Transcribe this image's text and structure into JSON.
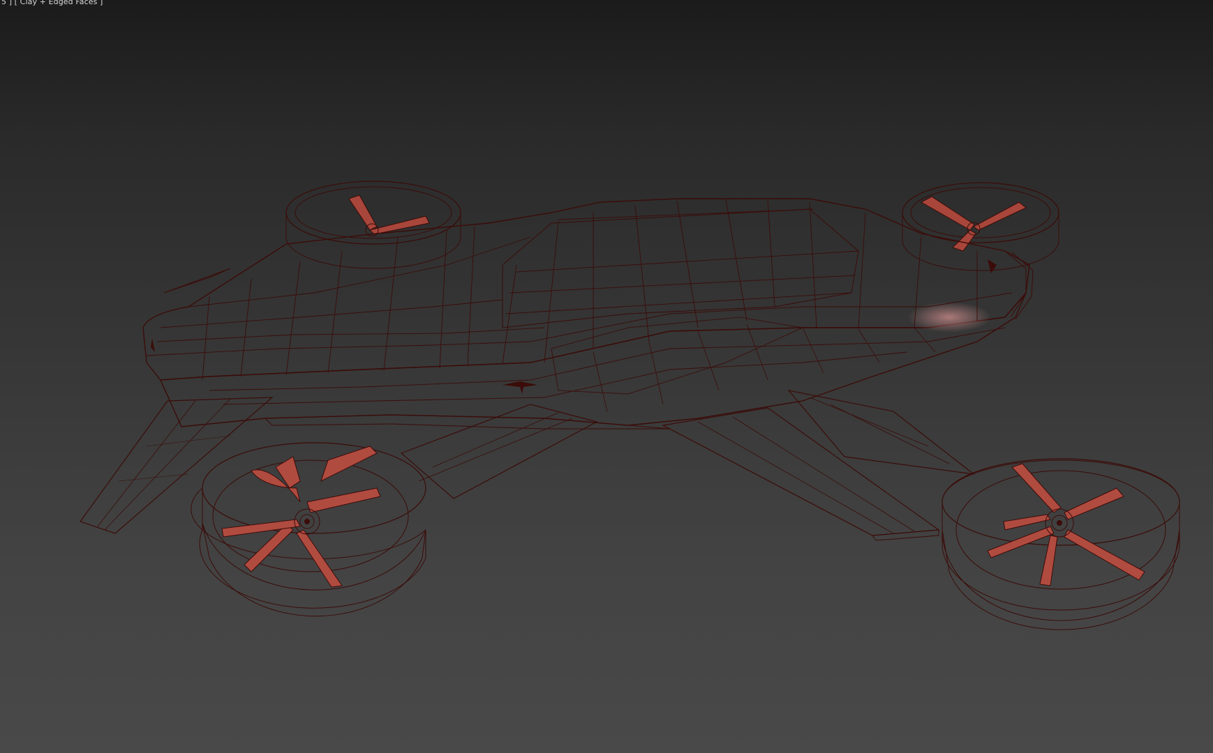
{
  "viewport": {
    "label": "5 ] [ Clay + Edged Faces ]",
    "shading_mode": "Clay + Edged Faces",
    "background_top": "#1b1b1b",
    "background_bottom": "#494949",
    "clay_color": "#b54a3d",
    "clay_highlight": "#c86a5c",
    "clay_shadow": "#6e1e17",
    "edge_color": "#3b0c09"
  },
  "scene": {
    "object": "flying-car-model",
    "rotors": [
      "rear-left-rotor",
      "rear-right-rotor",
      "front-left-rotor",
      "front-right-rotor"
    ],
    "blades_per_rotor": 6
  }
}
